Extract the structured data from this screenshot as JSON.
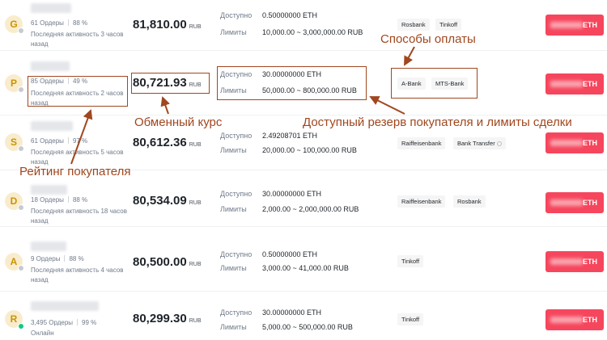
{
  "currency_label": "RUB",
  "available_label": "Доступно",
  "limits_label": "Лимиты",
  "buy_button_asset": "ETH",
  "ads": [
    {
      "avatar": "G",
      "orders": "61 Ордеры",
      "completion": "88 %",
      "activity": "Последняя активность 3 часов назад",
      "online": false,
      "price": "81,810.00",
      "available": "0.50000000 ETH",
      "limits": "10,000.00 ~ 3,000,000.00 RUB",
      "payments": [
        "Rosbank",
        "Tinkoff"
      ]
    },
    {
      "avatar": "P",
      "orders": "85 Ордеры",
      "completion": "49 %",
      "activity": "Последняя активность 2 часов назад",
      "online": false,
      "price": "80,721.93",
      "available": "30.00000000 ETH",
      "limits": "50,000.00 ~ 800,000.00 RUB",
      "payments": [
        "A-Bank",
        "MTS-Bank"
      ]
    },
    {
      "avatar": "S",
      "orders": "61 Ордеры",
      "completion": "97 %",
      "activity": "Последняя активность 5 часов назад",
      "online": false,
      "price": "80,612.36",
      "available": "2.49208701 ETH",
      "limits": "20,000.00 ~ 100,000.00 RUB",
      "payments": [
        "Raiffeisenbank",
        "Bank Transfer"
      ]
    },
    {
      "avatar": "D",
      "orders": "18 Ордеры",
      "completion": "88 %",
      "activity": "Последняя активность 18 часов назад",
      "online": false,
      "price": "80,534.09",
      "available": "30.00000000 ETH",
      "limits": "2,000.00 ~ 2,000,000.00 RUB",
      "payments": [
        "Raiffeisenbank",
        "Rosbank"
      ]
    },
    {
      "avatar": "A",
      "orders": "9 Ордеры",
      "completion": "88 %",
      "activity": "Последняя активность 4 часов назад",
      "online": false,
      "price": "80,500.00",
      "available": "0.50000000 ETH",
      "limits": "3,000.00 ~ 41,000.00 RUB",
      "payments": [
        "Tinkoff"
      ]
    },
    {
      "avatar": "R",
      "orders": "3,495 Ордеры",
      "completion": "99 %",
      "activity": "Онлайн",
      "online": true,
      "price": "80,299.30",
      "available": "30.00000000 ETH",
      "limits": "5,000.00 ~ 500,000.00 RUB",
      "payments": [
        "Tinkoff"
      ]
    }
  ],
  "annotations": {
    "payment_methods": "Способы оплаты",
    "exchange_rate": "Обменный курс",
    "reserve_and_limits": "Доступный резерв покупателя и лимиты сделки",
    "buyer_rating": "Рейтинг покупателя"
  },
  "colors": {
    "accent": "#a0471f",
    "buy": "#f6465d",
    "avatar_bg": "#f9eccd",
    "online": "#0ecb81"
  }
}
